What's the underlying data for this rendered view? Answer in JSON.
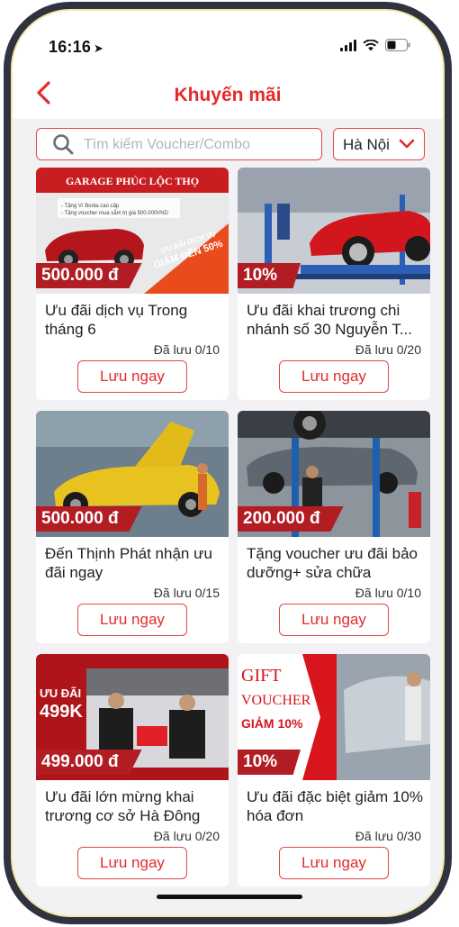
{
  "status_bar": {
    "time": "16:16",
    "location_glyph": "➤"
  },
  "header": {
    "title": "Khuyến mãi",
    "back_icon": "chevron-left-icon"
  },
  "search": {
    "placeholder": "Tìm kiếm Voucher/Combo",
    "value": ""
  },
  "city_select": {
    "selected": "Hà Nội"
  },
  "colors": {
    "accent": "#e32b2b",
    "price_tag": "#b21d24",
    "background": "#f2f2f4"
  },
  "vouchers": [
    {
      "badge": "500.000 đ",
      "name": "Ưu đãi dịch vụ Trong tháng 6",
      "saved": "Đã lưu 0/10",
      "button": "Lưu ngay",
      "banner_title": "GARAGE PHÚC LỘC THỌ",
      "banner_line1": "- Tặng Vì Bonia cao cấp",
      "banner_line2": "- Tặng voucher mua sắm trị giá 500.000VND",
      "banner_promo": "ƯU ĐÃI DỊCH VỤ",
      "banner_discount": "GIẢM ĐẾN 50%"
    },
    {
      "badge": "10%",
      "name": "Ưu đãi khai trương chi nhánh số 30 Nguyễn T...",
      "saved": "Đã lưu 0/20",
      "button": "Lưu ngay"
    },
    {
      "badge": "500.000 đ",
      "name": "Đến Thịnh Phát nhận ưu đãi ngay",
      "saved": "Đã lưu 0/15",
      "button": "Lưu ngay"
    },
    {
      "badge": "200.000 đ",
      "name": "Tặng voucher ưu đãi bảo dưỡng+ sửa chữa",
      "saved": "Đã lưu 0/10",
      "button": "Lưu ngay"
    },
    {
      "badge": "499.000 đ",
      "name": "Ưu đãi lớn mừng khai trương cơ sở Hà Đông",
      "saved": "Đã lưu 0/20",
      "button": "Lưu ngay",
      "banner_line1": "ƯU ĐÃI",
      "banner_line2": "499K"
    },
    {
      "badge": "10%",
      "name": "Ưu đãi đặc biệt giảm 10% hóa đơn",
      "saved": "Đã lưu 0/30",
      "button": "Lưu ngay",
      "banner_line1": "GIFT",
      "banner_line2": "VOUCHER",
      "banner_line3": "GIẢM 10%"
    }
  ]
}
